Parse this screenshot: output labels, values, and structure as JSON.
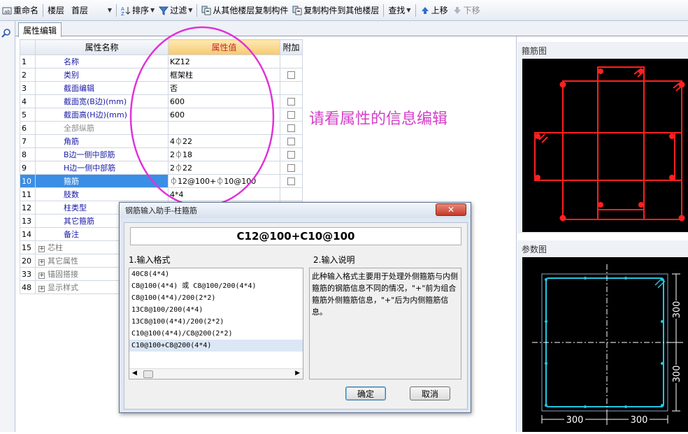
{
  "toolbar": {
    "rename": "重命名",
    "floor_label": "楼层",
    "floor_value": "首层",
    "sort": "排序",
    "filter": "过滤",
    "copy_from": "从其他楼层复制构件",
    "copy_to": "复制构件到其他楼层",
    "find": "查找",
    "move_up": "上移",
    "move_down": "下移"
  },
  "tab": "属性编辑",
  "grid": {
    "headers": {
      "name": "属性名称",
      "value": "属性值",
      "extra": "附加"
    },
    "rows": [
      {
        "no": "1",
        "name": "名称",
        "value": "KZ12",
        "check": false
      },
      {
        "no": "2",
        "name": "类别",
        "value": "框架柱",
        "check": true
      },
      {
        "no": "3",
        "name": "截面编辑",
        "value": "否",
        "check": false
      },
      {
        "no": "4",
        "name": "截面宽(B边)(mm)",
        "value": "600",
        "check": true
      },
      {
        "no": "5",
        "name": "截面高(H边)(mm)",
        "value": "600",
        "check": true
      },
      {
        "no": "6",
        "name": "全部纵筋",
        "value": "",
        "check": true
      },
      {
        "no": "7",
        "name": "角筋",
        "value": "4⏀22",
        "check": true
      },
      {
        "no": "8",
        "name": "B边一侧中部筋",
        "value": "2⏀18",
        "check": true
      },
      {
        "no": "9",
        "name": "H边一侧中部筋",
        "value": "2⏀22",
        "check": true
      },
      {
        "no": "10",
        "name": "箍筋",
        "value": "⏀12@100+⏀10@100",
        "check": true
      },
      {
        "no": "11",
        "name": "肢数",
        "value": "4*4",
        "check": false
      },
      {
        "no": "12",
        "name": "柱类型",
        "value": "",
        "check": false
      },
      {
        "no": "13",
        "name": "其它箍筋",
        "value": "",
        "check": false
      },
      {
        "no": "14",
        "name": "备注",
        "value": "",
        "check": false
      }
    ],
    "groups": [
      {
        "no": "15",
        "name": "芯柱"
      },
      {
        "no": "20",
        "name": "其它属性"
      },
      {
        "no": "33",
        "name": "锚固搭接"
      },
      {
        "no": "48",
        "name": "显示样式"
      }
    ]
  },
  "annotation": "请看属性的信息编辑",
  "dialog": {
    "title": "钢筋输入助手-柱箍筋",
    "input_value": "C12@100+C10@100",
    "section1": "1.输入格式",
    "section2": "2.输入说明",
    "formats": [
      "40C8(4*4)",
      "C8@100(4*4) 或 C8@100/200(4*4)",
      "C8@100(4*4)/200(2*2)",
      "13C8@100/200(4*4)",
      "13C8@100(4*4)/200(2*2)",
      "C10@100(4*4)/C8@200(2*2)",
      "C10@100+C8@200(4*4)"
    ],
    "description": "此种输入格式主要用于处理外侧箍筋与内侧箍筋的钢筋信息不同的情况，\"+\"前为组合箍筋外侧箍筋信息，\"+\"后为内侧箍筋信息。",
    "ok": "确定",
    "cancel": "取消"
  },
  "panels": {
    "stirrup_title": "箍筋图",
    "param_title": "参数图",
    "dim_300": "300"
  },
  "colors": {
    "accent": "#3a8ee6",
    "annotation": "#d33fc8",
    "rebar": "#ff2020",
    "param": "#22c6e0"
  }
}
